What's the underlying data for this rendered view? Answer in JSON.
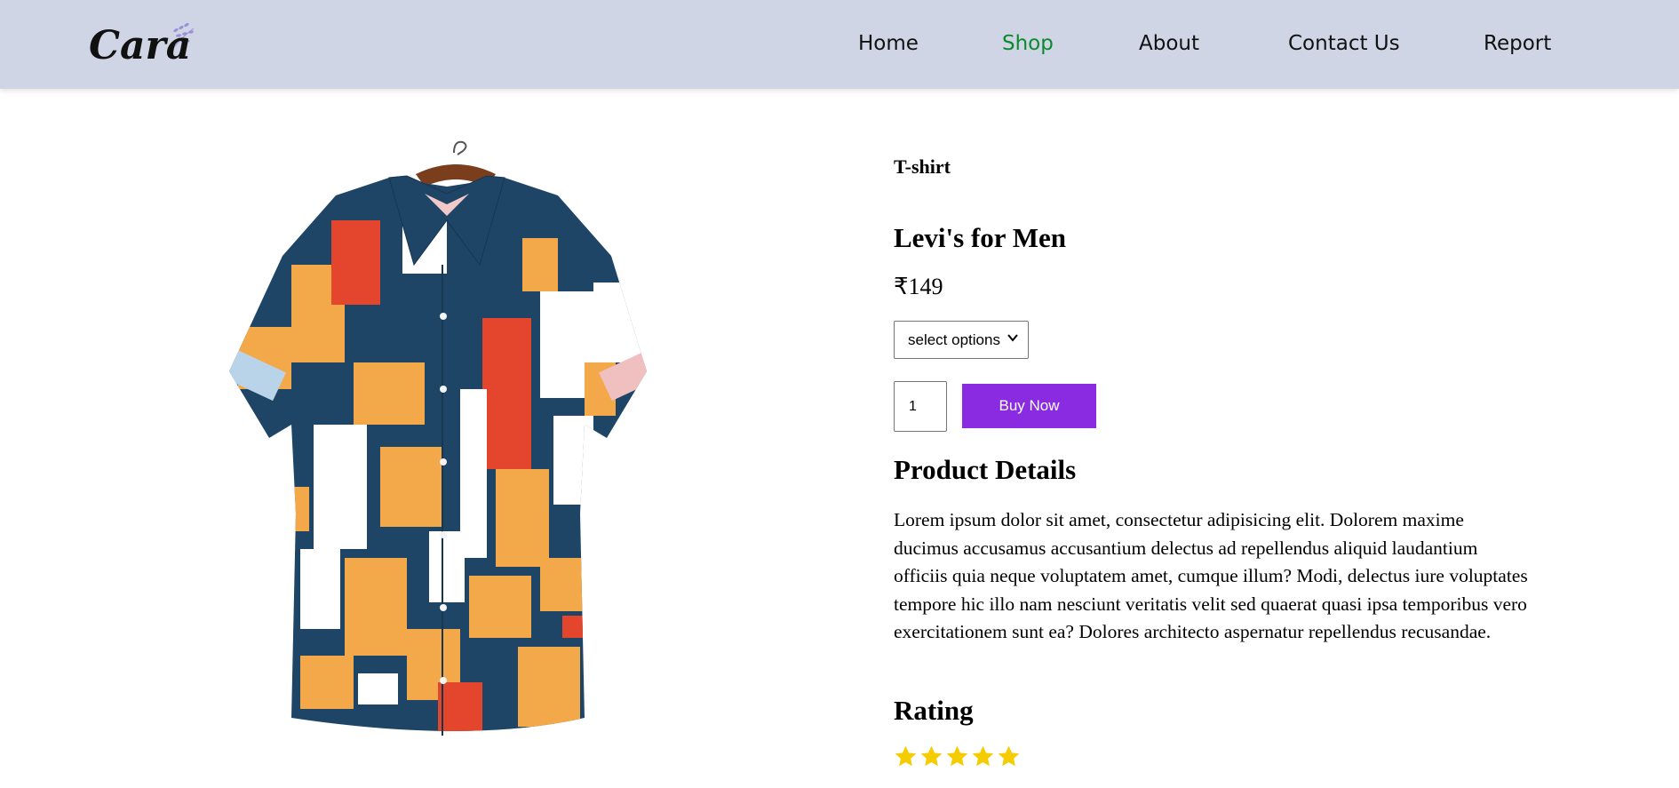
{
  "header": {
    "logo_text": "Cara",
    "nav": [
      {
        "label": "Home",
        "active": false
      },
      {
        "label": "Shop",
        "active": true
      },
      {
        "label": "About",
        "active": false
      },
      {
        "label": "Contact Us",
        "active": false
      },
      {
        "label": "Report",
        "active": false
      }
    ]
  },
  "product": {
    "category": "T-shirt",
    "title": "Levi's for Men",
    "price": "₹149",
    "select": {
      "value": "select options"
    },
    "quantity": "1",
    "buy_label": "Buy Now",
    "details_heading": "Product Details",
    "description": "Lorem ipsum dolor sit amet, consectetur adipisicing elit. Dolorem maxime ducimus accusamus accusantium delectus ad repellendus aliquid laudantium officiis quia neque voluptatem amet, cumque illum? Modi, delectus iure voluptates tempore hic illo nam nesciunt veritatis velit sed quaerat quasi ipsa temporibus vero exercitationem sunt ea? Dolores architecto aspernatur repellendus recusandae.",
    "rating_heading": "Rating",
    "rating": 5,
    "rating_max": 5
  },
  "colors": {
    "header_bg": "#d0d5e6",
    "nav_active": "#088a2d",
    "buy_button": "#8a2be2",
    "star": "#f5cc00"
  }
}
